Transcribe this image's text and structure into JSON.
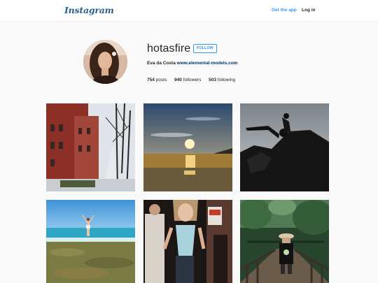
{
  "header": {
    "logo_text": "Instagram",
    "get_app_label": "Get the app",
    "login_label": "Log in"
  },
  "profile": {
    "username": "hotasfire",
    "follow_label": "FOLLOW",
    "full_name": "Eva da Costa",
    "website": "www.elemental-models.com",
    "stats": {
      "posts_count": "754",
      "posts_label": "posts",
      "followers_count": "940",
      "followers_label": "followers",
      "following_count": "503",
      "following_label": "following"
    }
  },
  "colors": {
    "link_blue": "#3897f0",
    "bio_link": "#003569",
    "page_bg": "#fafafa"
  },
  "posts": [
    {
      "subject": "city street with brick buildings and bare trees"
    },
    {
      "subject": "sunset over beach"
    },
    {
      "subject": "person posing on dark rock"
    },
    {
      "subject": "woman on rocky shore with blue sea"
    },
    {
      "subject": "woman in crowd with light top"
    },
    {
      "subject": "person on wooden bridge in forest"
    }
  ]
}
